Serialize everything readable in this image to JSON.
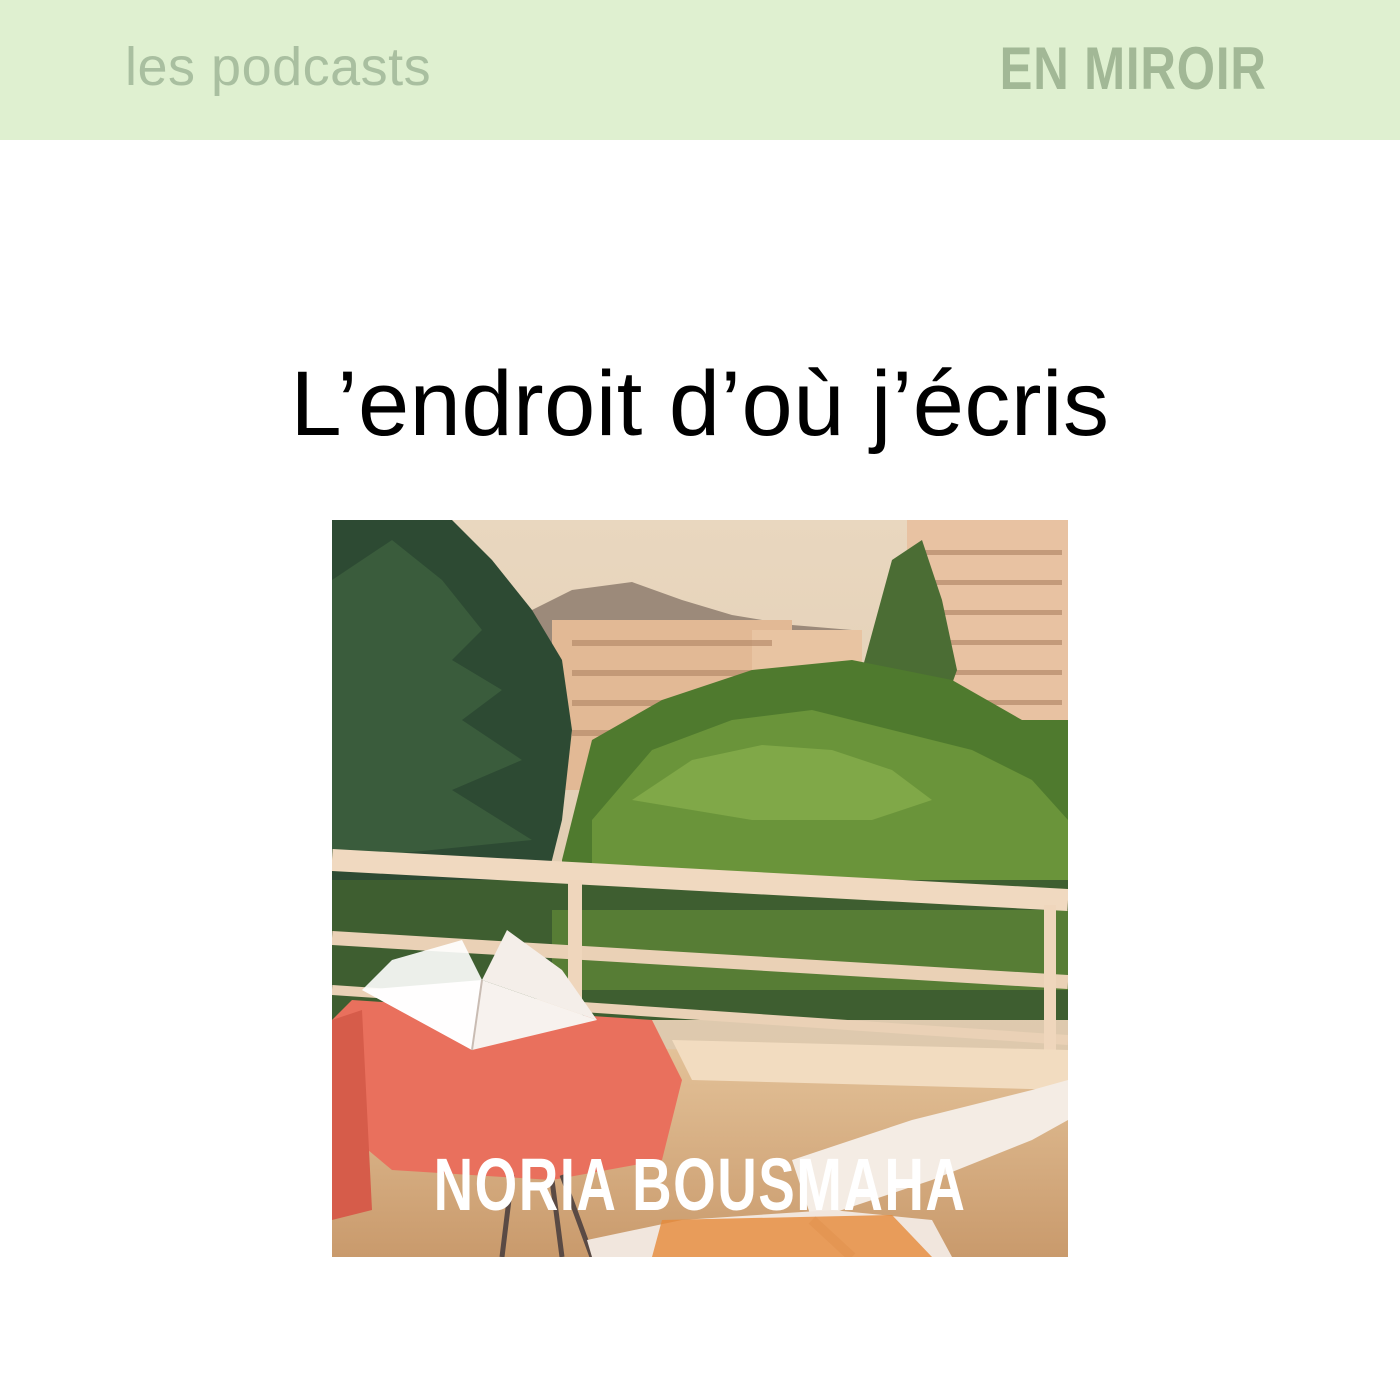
{
  "header": {
    "left_label": "les podcasts",
    "right_label": "EN MIROIR",
    "background": "#dff0d0",
    "text_color": "#a9bfa0"
  },
  "episode": {
    "title": "L’endroit d’où j’écris",
    "cover_image": "balcony-view-photo",
    "author_name": "NORIA BOUSMAHA"
  }
}
